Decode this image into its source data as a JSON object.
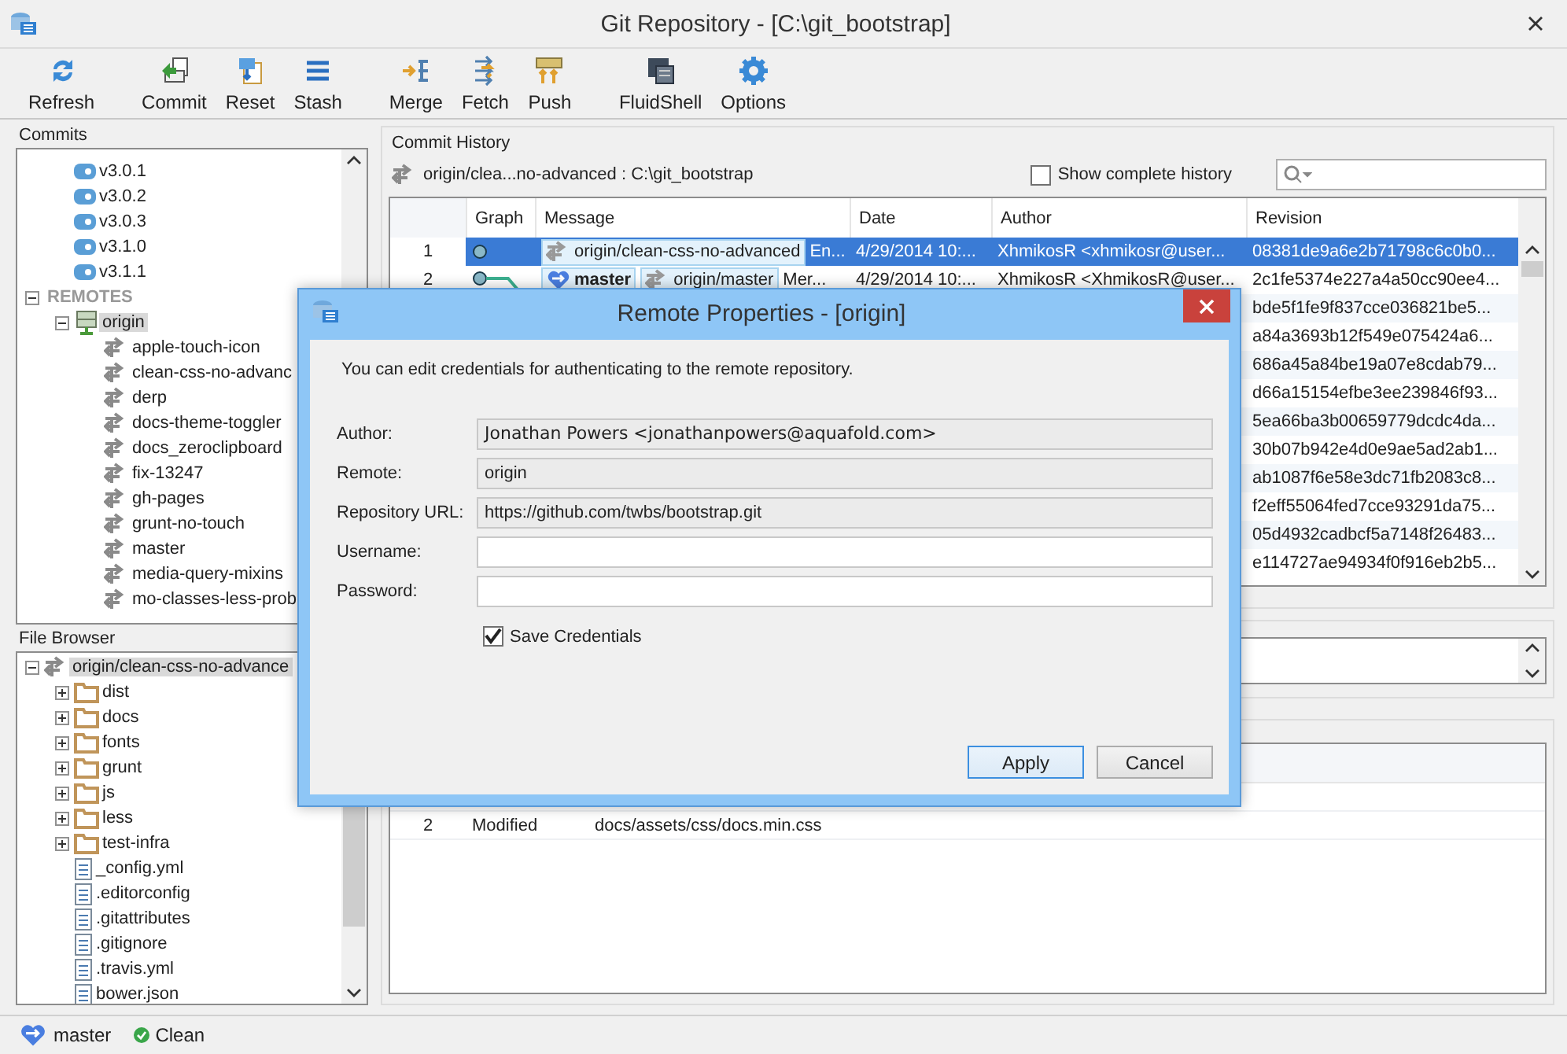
{
  "window": {
    "title": "Git Repository - [C:\\git_bootstrap]"
  },
  "toolbar": {
    "groups": [
      [
        "Refresh"
      ],
      [
        "Commit",
        "Reset",
        "Stash"
      ],
      [
        "Merge",
        "Fetch",
        "Push"
      ],
      [
        "FluidShell",
        "Options"
      ]
    ]
  },
  "commits_panel": {
    "title": "Commits",
    "tree": [
      {
        "kind": "group",
        "children": [
          {
            "label": "v3.0.1",
            "kind": "tag"
          },
          {
            "label": "v3.0.2",
            "kind": "tag"
          },
          {
            "label": "v3.0.3",
            "kind": "tag"
          },
          {
            "label": "v3.1.0",
            "kind": "tag"
          },
          {
            "label": "v3.1.1",
            "kind": "tag"
          }
        ]
      },
      {
        "label": "REMOTES",
        "kind": "section",
        "expanded": true,
        "children": [
          {
            "label": "origin",
            "kind": "remote",
            "expanded": true,
            "selected": true,
            "children": [
              {
                "label": "apple-touch-icon",
                "kind": "branch",
                "selected": false
              },
              {
                "label": "clean-css-no-advanc",
                "kind": "branch",
                "selected": false
              },
              {
                "label": "derp",
                "kind": "branch",
                "selected": false
              },
              {
                "label": "docs-theme-toggler",
                "kind": "branch",
                "selected": false
              },
              {
                "label": "docs_zeroclipboard",
                "kind": "branch",
                "selected": false
              },
              {
                "label": "fix-13247",
                "kind": "branch",
                "selected": false
              },
              {
                "label": "gh-pages",
                "kind": "branch",
                "selected": false
              },
              {
                "label": "grunt-no-touch",
                "kind": "branch",
                "selected": false
              },
              {
                "label": "master",
                "kind": "branch",
                "selected": false
              },
              {
                "label": "media-query-mixins",
                "kind": "branch",
                "selected": false
              },
              {
                "label": "mo-classes-less-prob",
                "kind": "branch",
                "selected": false
              }
            ]
          }
        ]
      }
    ]
  },
  "file_browser": {
    "title": "File Browser",
    "tree": [
      {
        "label": "origin/clean-css-no-advance",
        "kind": "branch",
        "expanded": true,
        "selected": true,
        "children": [
          {
            "label": "dist",
            "kind": "folder",
            "expanded": false
          },
          {
            "label": "docs",
            "kind": "folder",
            "expanded": false
          },
          {
            "label": "fonts",
            "kind": "folder",
            "expanded": false
          },
          {
            "label": "grunt",
            "kind": "folder",
            "expanded": false
          },
          {
            "label": "js",
            "kind": "folder",
            "expanded": false
          },
          {
            "label": "less",
            "kind": "folder",
            "expanded": false
          },
          {
            "label": "test-infra",
            "kind": "folder",
            "expanded": false
          },
          {
            "label": "_config.yml",
            "kind": "file"
          },
          {
            "label": ".editorconfig",
            "kind": "file"
          },
          {
            "label": ".gitattributes",
            "kind": "file"
          },
          {
            "label": ".gitignore",
            "kind": "file"
          },
          {
            "label": ".travis.yml",
            "kind": "file"
          },
          {
            "label": "bower.json",
            "kind": "file"
          }
        ]
      }
    ]
  },
  "commit_history": {
    "title": "Commit History",
    "path": "origin/clea...no-advanced : C:\\git_bootstrap",
    "show_complete_history": {
      "label": "Show complete history",
      "checked": false
    },
    "table": {
      "columns": [
        "Graph",
        "Message",
        "Date",
        "Author",
        "Revision"
      ],
      "rows": [
        {
          "number": "1",
          "selected": true,
          "refs": [
            {
              "label": "origin/clean-css-no-advanced",
              "kind": "remote"
            }
          ],
          "message": "En...",
          "date": "4/29/2014 10:...",
          "author": "XhmikosR <xhmikosr@user...",
          "revision": "08381de9a6e2b71798c6c0b0..."
        },
        {
          "number": "2",
          "selected": false,
          "refs": [
            {
              "label": "master",
              "kind": "local"
            },
            {
              "label": "origin/master",
              "kind": "remote"
            }
          ],
          "message": "Mer...",
          "date": "4/29/2014 10:...",
          "author": "XhmikosR <XhmikosR@user...",
          "revision": "2c1fe5374e227a4a50cc90ee4..."
        },
        {
          "selected": false,
          "revision": "bde5f1fe9f837cce036821be5..."
        },
        {
          "selected": false,
          "revision": "a84a3693b12f549e075424a6..."
        },
        {
          "selected": false,
          "revision": "686a45a84be19a07e8cdab79..."
        },
        {
          "selected": false,
          "revision": "d66a15154efbe3ee239846f93..."
        },
        {
          "selected": false,
          "revision": "5ea66ba3b00659779dcdc4da..."
        },
        {
          "selected": false,
          "revision": "30b07b942e4d0e9ae5ad2ab1..."
        },
        {
          "selected": false,
          "revision": "ab1087f6e58e3dc71fb2083c8..."
        },
        {
          "selected": false,
          "revision": "f2eff55064fed7cce93291da75..."
        },
        {
          "selected": false,
          "revision": "05d4932cadbcf5a7148f26483..."
        },
        {
          "selected": false,
          "revision": "e114727ae94934f0f916eb2b5..."
        }
      ]
    }
  },
  "changes": {
    "rows": [
      {
        "number": "2",
        "status": "Modified",
        "path": "docs/assets/css/docs.min.css"
      }
    ]
  },
  "status_bar": {
    "branch": "master",
    "status": "Clean"
  },
  "dialog": {
    "title": "Remote Properties - [origin]",
    "message": "You can edit credentials for authenticating to the remote repository.",
    "fields": [
      {
        "label": "Author:",
        "value": "Jonathan Powers <jonathanpowers@aquafold.com>",
        "disabled": true
      },
      {
        "label": "Remote:",
        "value": "origin",
        "disabled": true
      },
      {
        "label": "Repository URL:",
        "value": "https://github.com/twbs/bootstrap.git",
        "disabled": true
      },
      {
        "label": "Username:",
        "disabled": false
      },
      {
        "label": "Password:",
        "disabled": false
      }
    ],
    "save_credentials": {
      "label": "Save Credentials",
      "checked": true
    },
    "buttons": [
      {
        "label": "Apply",
        "default": true
      },
      {
        "label": "Cancel",
        "default": false
      }
    ]
  }
}
